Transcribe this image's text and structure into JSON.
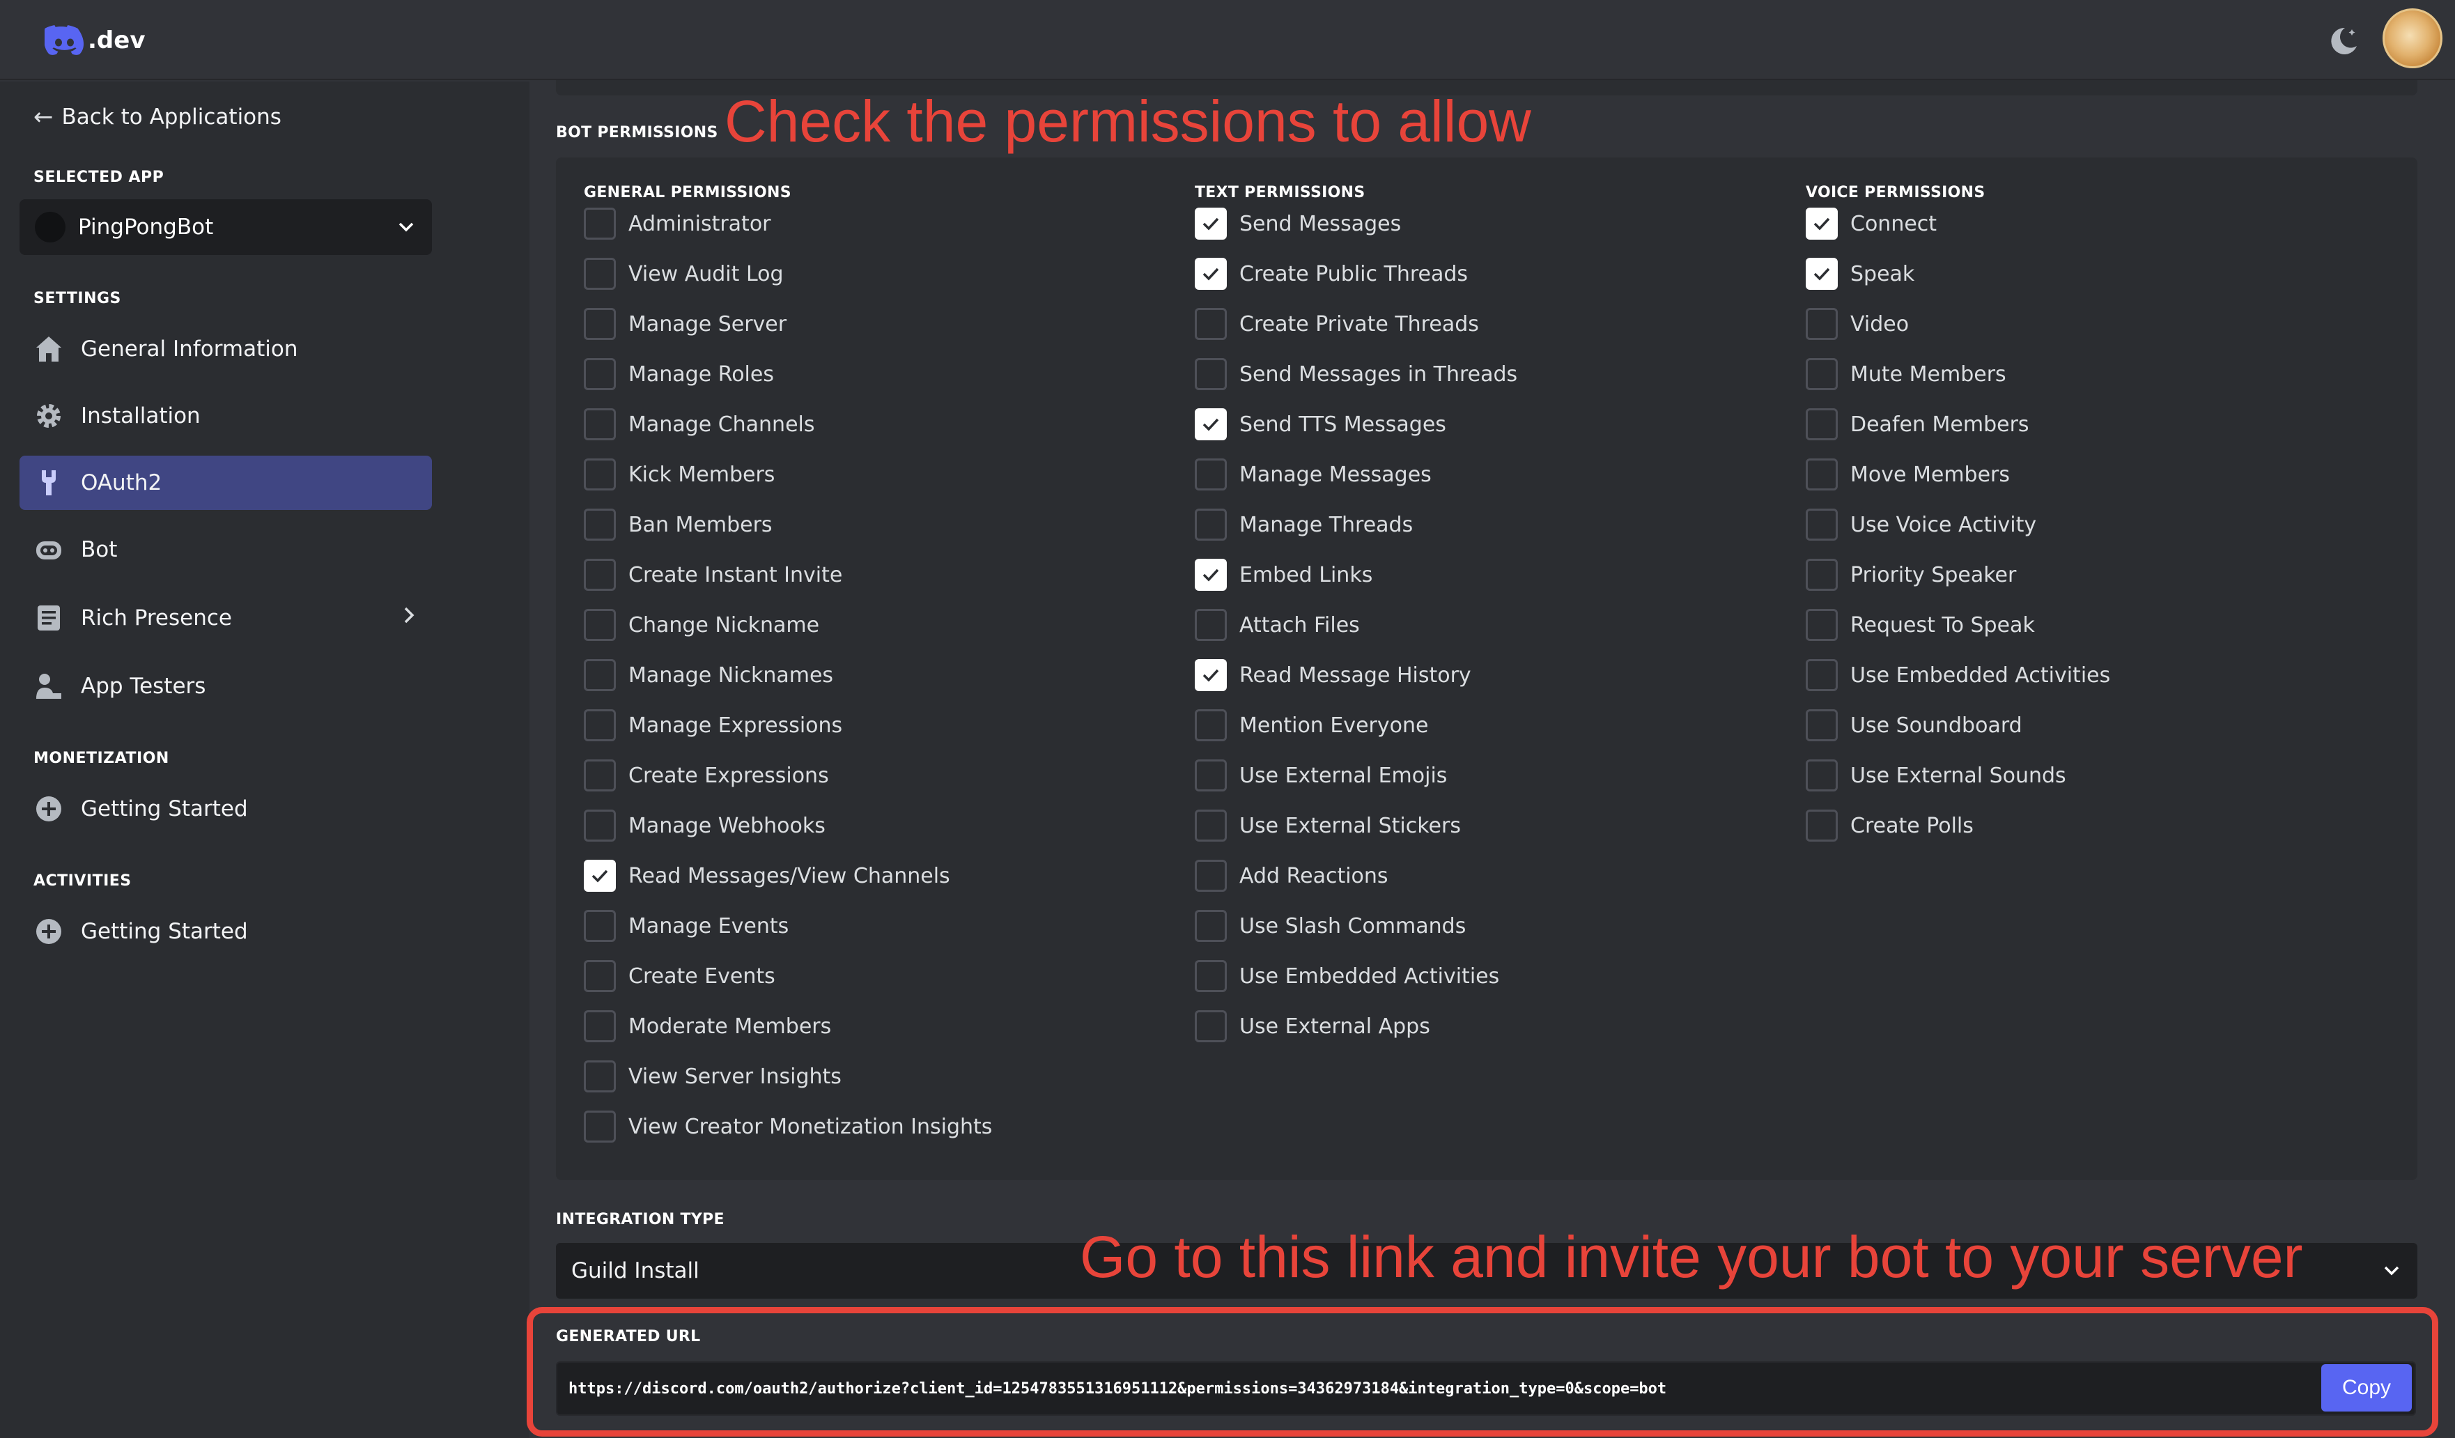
{
  "header": {
    "logo_text": ".dev",
    "theme_icon": "moon-icon",
    "avatar": "user-avatar"
  },
  "sidebar": {
    "back_label": "Back to Applications",
    "selected_app_label": "SELECTED APP",
    "selected_app_name": "PingPongBot",
    "settings_label": "SETTINGS",
    "items": [
      {
        "label": "General Information",
        "icon": "home-icon"
      },
      {
        "label": "Installation",
        "icon": "gear-icon"
      },
      {
        "label": "OAuth2",
        "icon": "wrench-icon",
        "active": true
      },
      {
        "label": "Bot",
        "icon": "bot-icon"
      },
      {
        "label": "Rich Presence",
        "icon": "document-icon"
      },
      {
        "label": "App Testers",
        "icon": "user-icon"
      }
    ],
    "monetization_label": "MONETIZATION",
    "monetization_item": "Getting Started",
    "activities_label": "ACTIVITIES",
    "activities_item": "Getting Started"
  },
  "annotations": {
    "top": "Check the permissions to allow",
    "bottom": "Go to this link and invite your bot to your server"
  },
  "bot_permissions_label": "BOT PERMISSIONS",
  "permissions": {
    "general": {
      "title": "GENERAL PERMISSIONS",
      "items": [
        {
          "label": "Administrator",
          "checked": false
        },
        {
          "label": "View Audit Log",
          "checked": false
        },
        {
          "label": "Manage Server",
          "checked": false
        },
        {
          "label": "Manage Roles",
          "checked": false
        },
        {
          "label": "Manage Channels",
          "checked": false
        },
        {
          "label": "Kick Members",
          "checked": false
        },
        {
          "label": "Ban Members",
          "checked": false
        },
        {
          "label": "Create Instant Invite",
          "checked": false
        },
        {
          "label": "Change Nickname",
          "checked": false
        },
        {
          "label": "Manage Nicknames",
          "checked": false
        },
        {
          "label": "Manage Expressions",
          "checked": false
        },
        {
          "label": "Create Expressions",
          "checked": false
        },
        {
          "label": "Manage Webhooks",
          "checked": false
        },
        {
          "label": "Read Messages/View Channels",
          "checked": true
        },
        {
          "label": "Manage Events",
          "checked": false
        },
        {
          "label": "Create Events",
          "checked": false
        },
        {
          "label": "Moderate Members",
          "checked": false
        },
        {
          "label": "View Server Insights",
          "checked": false
        },
        {
          "label": "View Creator Monetization Insights",
          "checked": false
        }
      ]
    },
    "text": {
      "title": "TEXT PERMISSIONS",
      "items": [
        {
          "label": "Send Messages",
          "checked": true
        },
        {
          "label": "Create Public Threads",
          "checked": true
        },
        {
          "label": "Create Private Threads",
          "checked": false
        },
        {
          "label": "Send Messages in Threads",
          "checked": false
        },
        {
          "label": "Send TTS Messages",
          "checked": true
        },
        {
          "label": "Manage Messages",
          "checked": false
        },
        {
          "label": "Manage Threads",
          "checked": false
        },
        {
          "label": "Embed Links",
          "checked": true
        },
        {
          "label": "Attach Files",
          "checked": false
        },
        {
          "label": "Read Message History",
          "checked": true
        },
        {
          "label": "Mention Everyone",
          "checked": false
        },
        {
          "label": "Use External Emojis",
          "checked": false
        },
        {
          "label": "Use External Stickers",
          "checked": false
        },
        {
          "label": "Add Reactions",
          "checked": false
        },
        {
          "label": "Use Slash Commands",
          "checked": false
        },
        {
          "label": "Use Embedded Activities",
          "checked": false
        },
        {
          "label": "Use External Apps",
          "checked": false
        }
      ]
    },
    "voice": {
      "title": "VOICE PERMISSIONS",
      "items": [
        {
          "label": "Connect",
          "checked": true
        },
        {
          "label": "Speak",
          "checked": true
        },
        {
          "label": "Video",
          "checked": false
        },
        {
          "label": "Mute Members",
          "checked": false
        },
        {
          "label": "Deafen Members",
          "checked": false
        },
        {
          "label": "Move Members",
          "checked": false
        },
        {
          "label": "Use Voice Activity",
          "checked": false
        },
        {
          "label": "Priority Speaker",
          "checked": false
        },
        {
          "label": "Request To Speak",
          "checked": false
        },
        {
          "label": "Use Embedded Activities",
          "checked": false
        },
        {
          "label": "Use Soundboard",
          "checked": false
        },
        {
          "label": "Use External Sounds",
          "checked": false
        },
        {
          "label": "Create Polls",
          "checked": false
        }
      ]
    }
  },
  "integration": {
    "label": "INTEGRATION TYPE",
    "value": "Guild Install"
  },
  "generated_url": {
    "label": "GENERATED URL",
    "value": "https://discord.com/oauth2/authorize?client_id=1254783551316951112&permissions=34362973184&integration_type=0&scope=bot",
    "copy_label": "Copy"
  },
  "colors": {
    "accent": "#5865f2",
    "annotation": "#e8443a",
    "active_nav": "#404683"
  }
}
